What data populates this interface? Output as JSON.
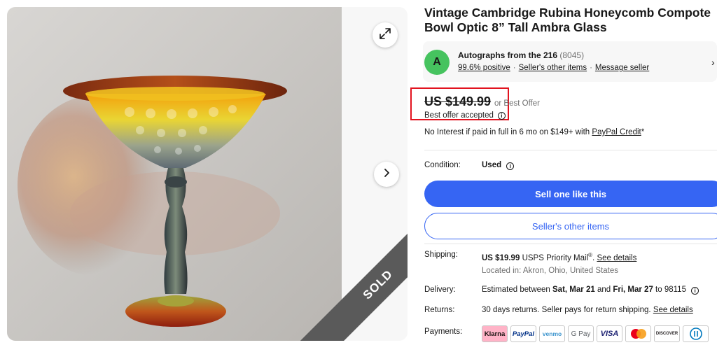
{
  "listing": {
    "title": "Vintage Cambridge Rubina Honeycomb Compote Bowl Optic 8” Tall Ambra Glass",
    "sold_label": "SOLD"
  },
  "seller": {
    "avatar_letter": "A",
    "name": "Autographs from the 216",
    "feedback_count": "(8045)",
    "positive": "99.6% positive",
    "other_items_link": "Seller's other items",
    "message_link": "Message seller"
  },
  "price": {
    "amount": "US $149.99",
    "best_offer": "or Best Offer",
    "offer_accepted": "Best offer accepted",
    "financing_text": "No Interest if paid in full in 6 mo on $149+ with ",
    "financing_link": "PayPal Credit",
    "financing_suffix": "*"
  },
  "condition": {
    "label": "Condition:",
    "value": "Used"
  },
  "buttons": {
    "sell_one": "Sell one like this",
    "sellers_other_items": "Seller's other items"
  },
  "shipping": {
    "label": "Shipping:",
    "cost": "US $19.99",
    "service": "USPS Priority Mail",
    "service_mark": "®",
    "details_link": "See details",
    "location": "Located in: Akron, Ohio, United States"
  },
  "delivery": {
    "label": "Delivery:",
    "prefix": "Estimated between ",
    "start": "Sat, Mar 21",
    "and": " and ",
    "end": "Fri, Mar 27",
    "suffix": " to 98115"
  },
  "returns": {
    "label": "Returns:",
    "text": "30 days returns. Seller pays for return shipping. ",
    "details_link": "See details"
  },
  "payments": {
    "label": "Payments:",
    "methods": [
      "Klarna",
      "PayPal",
      "venmo",
      "G Pay",
      "VISA",
      "Mastercard",
      "DISCOVER",
      "Diners Club"
    ]
  },
  "colors": {
    "primary_blue": "#3665f3",
    "highlight_red": "#e2131f",
    "avatar_green": "#46c35f",
    "sold_ribbon": "#5a5a5a"
  }
}
